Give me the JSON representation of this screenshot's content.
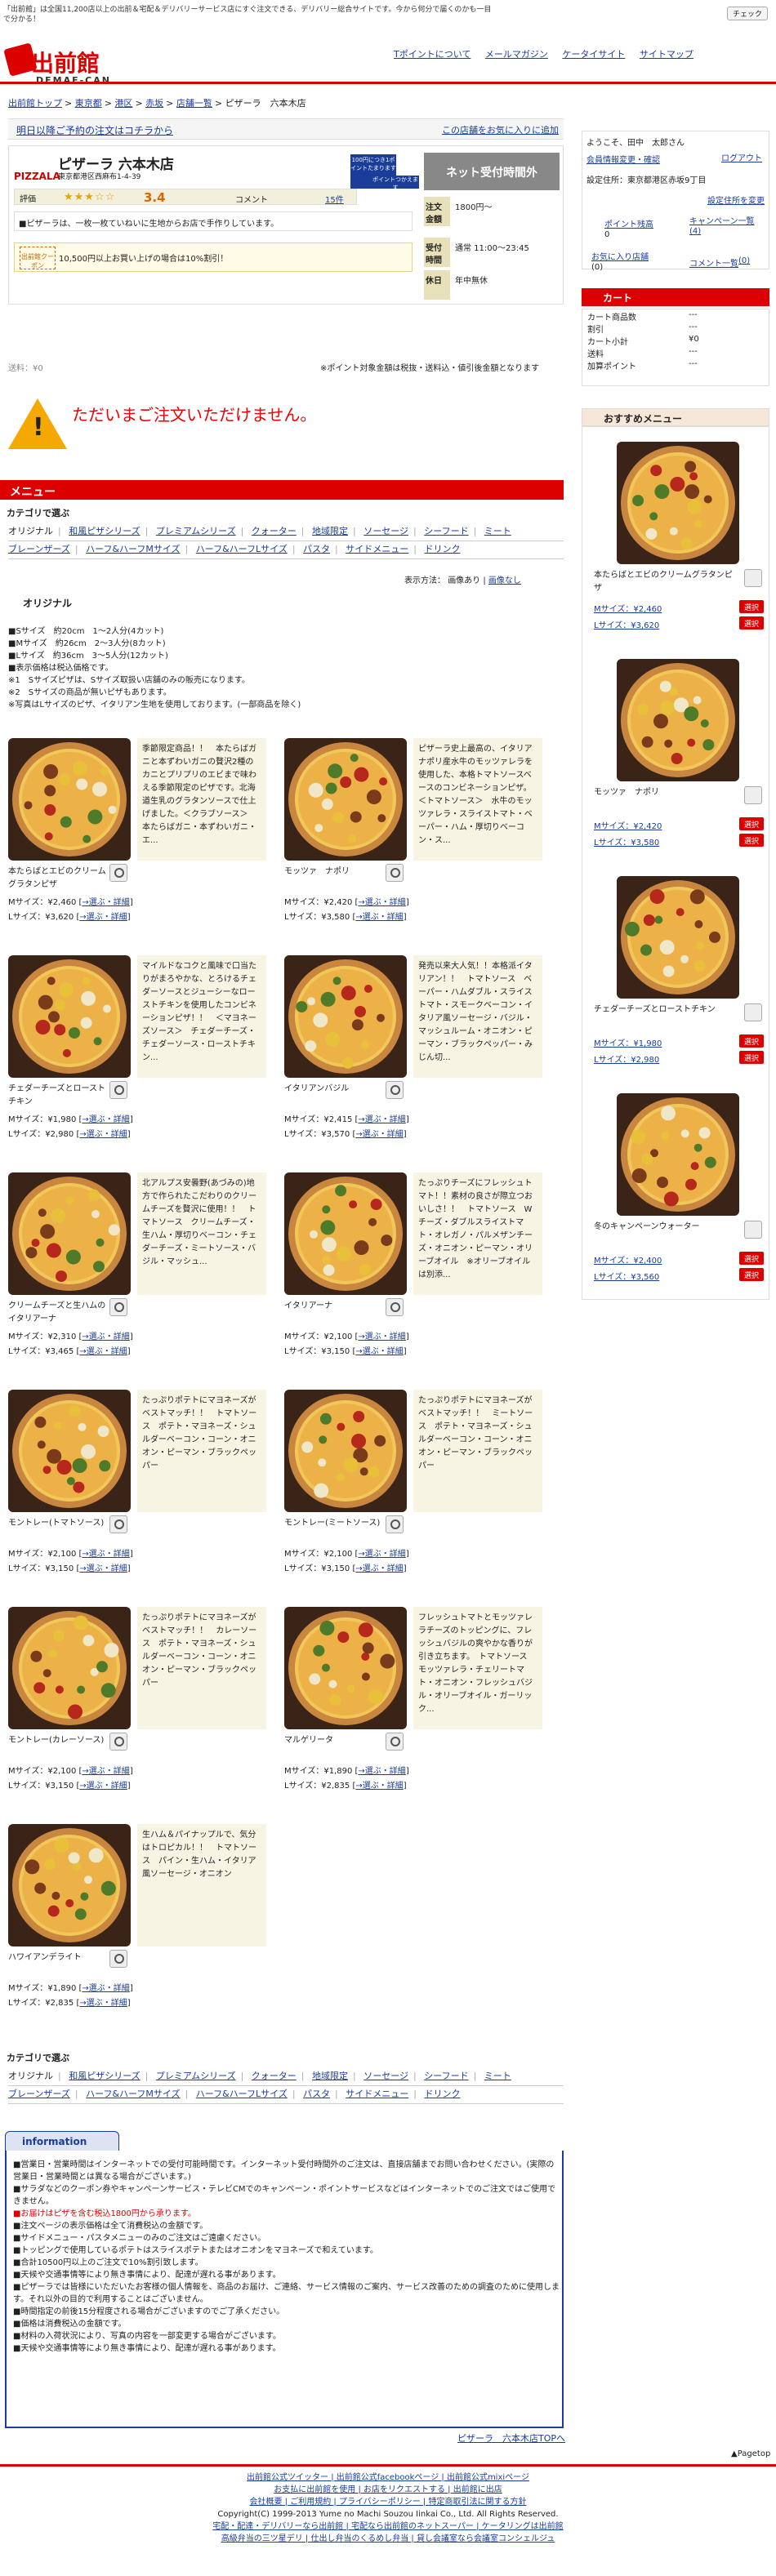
{
  "top_note": "「出前館」は全国11,200店以上の出前＆宅配＆デリバリーサービス店にすぐ注文できる、デリバリー総合サイトです。今から何分で届くのかも一目で分かる！",
  "check_label": "チェック",
  "logo": {
    "name": "出前館",
    "sub": "DEMAE-CAN"
  },
  "top_links": [
    "Tポイントについて",
    "メールマガジン",
    "ケータイサイト",
    "サイトマップ"
  ],
  "breadcrumb": [
    "出前館トップ",
    "東京都",
    "港区",
    "赤坂",
    "店舗一覧",
    "ピザーラ　六本木店"
  ],
  "reservation": {
    "left": "明日以降ご予約の注文はコチラから",
    "right": "この店舗をお気に入りに追加"
  },
  "shop": {
    "brand": "PIZZALA",
    "name": "ピザーラ 六本木店",
    "address": "東京都港区西麻布1-4-39",
    "tpoint_badge": "100円につき1ポイントたまります",
    "tpoint_use": "ポイントつかえます",
    "rating_label": "評価",
    "stars": "★★★☆☆",
    "score": "3.4",
    "comment_label": "コメント",
    "comment_count": "15件",
    "description": "■ピザーラは、一枚一枚ていねいに生地からお店で手作りしています。",
    "coupon_tag": "出前館クーポン",
    "coupon_text": "10,500円以上お買い上げの場合は10%割引！",
    "net_time_label": "ネット受付時間外",
    "min_order_label": "注文金額",
    "min_order_value": "1800円～",
    "hours_label": "受付時間",
    "hours_value": "通常 11:00～23:45",
    "holiday_label": "休日",
    "holiday_value": "年中無休"
  },
  "shipping": "送料：¥0",
  "ship_note": "※ポイント対象金額は税抜・送料込・値引後金額となります",
  "sorry": "ただいまご注文いただけません。",
  "menu_heading": "メニュー",
  "category_heading": "カテゴリで選ぶ",
  "categories": [
    "オリジナル",
    "和風ピザシリーズ",
    "プレミアムシリーズ",
    "クォーター",
    "地域限定",
    "ソーセージ",
    "シーフード",
    "ミート",
    "ブレーンザーズ",
    "ハーフ&ハーフMサイズ",
    "ハーフ&ハーフLサイズ",
    "パスタ",
    "サイドメニュー",
    "ドリンク"
  ],
  "display_mode": {
    "label": "表示方法：",
    "current": "画像あり",
    "alt": "画像なし"
  },
  "section_title": "オリジナル",
  "notes": [
    "■Sサイズ　約20cm　1〜2人分(4カット)",
    "■Mサイズ　約26cm　2〜3人分(8カット)",
    "■Lサイズ　約36cm　3〜5人分(12カット)",
    "■表示価格は税込価格です。",
    "※1　Sサイズピザは、Sサイズ取扱い店舗のみの販売になります。",
    "※2　Sサイズの商品が無いピザもあります。",
    "※写真はLサイズのピザ、イタリアン生地を使用しております。(一部商品を除く)"
  ],
  "items": [
    {
      "name": "本たらばとエビのクリームグラタンピザ",
      "desc": "季節限定商品！！　本たらばガニと本ずわいガニの贅沢2種のカニとプリプリのエビまで味わえる季節限定のピザです。北海道生乳のグラタンソースで仕上げました。＜クラブソース＞　本たらばガニ・本ずわいガニ・エ...",
      "m": "Mサイズ：¥2,460",
      "l": "Lサイズ：¥3,620",
      "pick": "→選ぶ・詳細"
    },
    {
      "name": "モッツァ　ナポリ",
      "desc": "ピザーラ史上最高の、イタリアナポリ産水牛のモッツァレラを使用した、本格トマトソースベースのコンビネーションピザ。＜トマトソース＞　水牛のモッツァレラ・スライストマト・ベーパー・ハム・厚切りベーコン・ス...",
      "m": "Mサイズ：¥2,420",
      "l": "Lサイズ：¥3,580",
      "pick": "→選ぶ・詳細"
    },
    {
      "name": "チェダーチーズとローストチキン",
      "desc": "マイルドなコクと風味で口当たりがまろやかな、とろけるチェダーソースとジューシーなローストチキンを使用したコンビネーションピザ！！　＜マヨネーズソース＞　チェダーチーズ・チェダーソース・ローストチキン...",
      "m": "Mサイズ：¥1,980",
      "l": "Lサイズ：¥2,980",
      "pick": "→選ぶ・詳細"
    },
    {
      "name": "イタリアンバジル",
      "desc": "発売以来大人気！！本格派イタリアン！！　トマトソース　ベーパー・ハムダブル・スライストマト・スモークベーコン・イタリア風ソーセージ・バジル・マッシュルーム・オニオン・ピーマン・ブラックペッパー・みじん切...",
      "m": "Mサイズ：¥2,415",
      "l": "Lサイズ：¥3,570",
      "pick": "→選ぶ・詳細"
    },
    {
      "name": "クリームチーズと生ハムのイタリアーナ",
      "desc": "北アルプス安曇野(あづみの)地方で作られたこだわりのクリームチーズを贅沢に使用！！　トマトソース　クリームチーズ・生ハム・厚切りベーコン・チェダーチーズ・ミートソース・バジル・マッシュ...",
      "m": "Mサイズ：¥2,310",
      "l": "Lサイズ：¥3,465",
      "pick": "→選ぶ・詳細"
    },
    {
      "name": "イタリアーナ",
      "desc": "たっぷりチーズにフレッシュトマト！！素材の良さが際立つおいしさ！！　トマトソース　Wチーズ・ダブルスライストマト・オレガノ・パルメザンチーズ・オニオン・ピーマン・オリーブオイル　※オリーブオイルは別添...",
      "m": "Mサイズ：¥2,100",
      "l": "Lサイズ：¥3,150",
      "pick": "→選ぶ・詳細"
    },
    {
      "name": "モントレー(トマトソース)",
      "desc": "たっぷりポテトにマヨネーズがベストマッチ！！　トマトソース　ポテト・マヨネーズ・シュルダーベーコン・コーン・オニオン・ピーマン・ブラックペッパー",
      "m": "Mサイズ：¥2,100",
      "l": "Lサイズ：¥3,150",
      "pick": "→選ぶ・詳細"
    },
    {
      "name": "モントレー(ミートソース)",
      "desc": "たっぷりポテトにマヨネーズがベストマッチ！！　ミートソース　ポテト・マヨネーズ・シュルダーベーコン・コーン・オニオン・ピーマン・ブラックペッパー",
      "m": "Mサイズ：¥2,100",
      "l": "Lサイズ：¥3,150",
      "pick": "→選ぶ・詳細"
    },
    {
      "name": "モントレー(カレーソース)",
      "desc": "たっぷりポテトにマヨネーズがベストマッチ！！　カレーソース　ポテト・マヨネーズ・シュルダーベーコン・コーン・オニオン・ピーマン・ブラックペッパー",
      "m": "Mサイズ：¥2,100",
      "l": "Lサイズ：¥3,150",
      "pick": "→選ぶ・詳細"
    },
    {
      "name": "マルゲリータ",
      "desc": "フレッシュトマトとモッツァレラチーズのトッピングに、フレッシュバジルの爽やかな香りが引き立ちます。　トマトソース　モッツァレラ・チェリートマト・オニオン・フレッシュバジル・オリーブオイル・ガーリック...",
      "m": "Mサイズ：¥1,890",
      "l": "Lサイズ：¥2,835",
      "pick": "→選ぶ・詳細"
    },
    {
      "name": "ハワイアンデライト",
      "desc": "生ハム＆パイナップルで、気分はトロピカル！！　トマトソース　パイン・生ハム・イタリア風ソーセージ・オニオン",
      "m": "Mサイズ：¥1,890",
      "l": "Lサイズ：¥2,835",
      "pick": "→選ぶ・詳細"
    }
  ],
  "info_tab": "information",
  "info_lines": [
    "■営業日・営業時間はインターネットでの受付可能時間です。インターネット受付時間外のご注文は、直接店舗までお問い合わせください。(実際の営業日・営業時間とは異なる場合がございます。)",
    "■サラダなどのクーポン券やキャンペーンサービス・テレビCMでのキャンペーン・ポイントサービスなどはインターネットでのご注文ではご使用できません。",
    "■お届けはピザを含む税込1800円から承ります。",
    "■注文ページの表示価格は全て消費税込の金額です。",
    "■サイドメニュー・パスタメニューのみのご注文はご遠慮ください。",
    "■トッピングで使用しているポテトはスライスポテトまたはオニオンをマヨネーズで和えています。",
    "■合計10500円以上のご注文で10%割引致します。",
    "■天候や交通事情等により無き事情により、配達が遅れる事があります。",
    "■ピザーラでは皆様にいただいたお客様の個人情報を、商品のお届け、ご連絡、サービス情報のご案内、サービス改善のための調査のために使用します。それ以外の目的で利用することはございません。",
    "■時間指定の前後15分程度される場合がございますのでご了承ください。",
    "■価格は消費税込の金額です。",
    "■材料の入荷状況により、写真の内容を一部変更する場合がございます。",
    "■天候や交通事情等により無き事情により、配達が遅れる事があります。"
  ],
  "toplink": "ピザーラ　六本木店TOPへ",
  "pagetop": "▲Pagetop",
  "footer_lines": [
    "出前館公式ツイッター | 出前館公式facebookページ | 出前館公式mixiページ",
    "お支払に出前館を使用 | お店をリクエストする | 出前館に出店",
    "会社概要 | ご利用規約 | プライバシーポリシー | 特定商取引法に関する方針",
    "Copyright(C) 1999-2013 Yume no Machi Souzou Iinkai Co., Ltd. All Rights Reserved.",
    "宅配・配達・デリバリーなら出前館 | 宅配なら出前館のネットスーパー | ケータリングは出前館",
    "高級弁当の三ツ星デリ | 仕出し弁当のくるめし弁当 | 貸し会議室なら会議室コンシェルジュ"
  ],
  "sidebar": {
    "greeting": "ようこそ、田中　太郎さん",
    "member_link": "会員情報変更・確認",
    "logout": "ログアウト",
    "setting_label": "設定住所：東京都港区赤坂9丁目",
    "setting_link": "設定住所を変更",
    "points_label": "ポイント残高",
    "points_value": "0",
    "campaign": "キャンペーン一覧",
    "campaign_count": "(4)",
    "favorites": "お気に入り店舗",
    "favorites_count": "(0)",
    "comments": "コメント一覧",
    "comments_count": "(0)"
  },
  "cart": {
    "title": "カート",
    "rows": [
      {
        "k": "カート商品数",
        "v": "---"
      },
      {
        "k": "割引",
        "v": "---"
      },
      {
        "k": "カート小計",
        "v": "¥0"
      },
      {
        "k": "送料",
        "v": "---"
      },
      {
        "k": "加算ポイント",
        "v": "---"
      }
    ]
  },
  "recommend": {
    "title": "おすすめメニュー",
    "select_label": "選択",
    "items": [
      {
        "name": "本たらばとエビのクリームグラタンピザ",
        "m": "Mサイズ：¥2,460",
        "l": "Lサイズ：¥3,620"
      },
      {
        "name": "モッツァ　ナポリ",
        "m": "Mサイズ：¥2,420",
        "l": "Lサイズ：¥3,580"
      },
      {
        "name": "チェダーチーズとローストチキン",
        "m": "Mサイズ：¥1,980",
        "l": "Lサイズ：¥2,980"
      },
      {
        "name": "冬のキャンペーンウォーター",
        "m": "Mサイズ：¥2,400",
        "l": "Lサイズ：¥3,560"
      }
    ]
  }
}
